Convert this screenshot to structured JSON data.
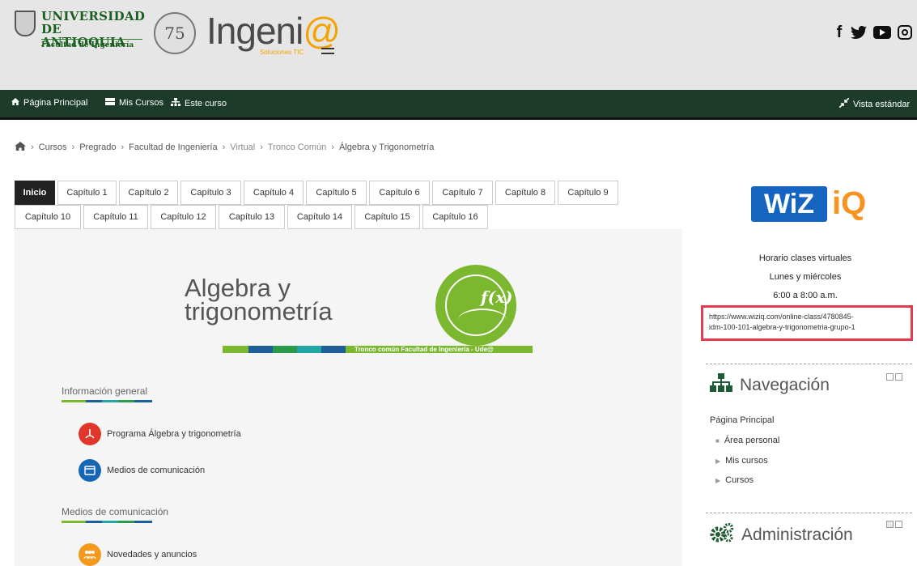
{
  "header": {
    "university_line1": "UNIVERSIDAD",
    "university_line2": "DE ANTIOQUIA",
    "faculty": "Facultad de Ingeniería",
    "anniversary": "75",
    "brand": "Ingeni",
    "brand_at": "@",
    "brand_sub": "Soluciones TIC",
    "social": {
      "facebook": "f",
      "twitter": "y"
    }
  },
  "navbar": {
    "home": "Página Principal",
    "my_courses": "Mis Cursos",
    "this_course": "Este curso",
    "view": "Vista estándar"
  },
  "breadcrumb": {
    "home_icon": "home-icon",
    "items": [
      "Cursos",
      "Pregrado",
      "Facultad de Ingeniería",
      "Virtual",
      "Tronco Común",
      "Álgebra y Trigonometría"
    ],
    "sep": "›"
  },
  "tabs": [
    "Inicio",
    "Capítulo 1",
    "Capítulo 2",
    "Capítulo 3",
    "Capítulo 4",
    "Capítulo 5",
    "Capítulo 6",
    "Capítulo 7",
    "Capítulo 8",
    "Capítulo 9",
    "Capítulo 10",
    "Capítulo 11",
    "Capítulo 12",
    "Capítulo 13",
    "Capítulo 14",
    "Capítulo 15",
    "Capítulo 16"
  ],
  "banner": {
    "title_line1": "Algebra y",
    "title_line2": "trigonometría",
    "fx": "f(x)",
    "stripe_text": "Tronco común Facultad de Ingeniería - Ude@"
  },
  "sections": {
    "general": {
      "title": "Información general",
      "items": [
        "Programa Álgebra y trigonometría",
        "Medios de comunicación"
      ]
    },
    "communication": {
      "title": "Medios de comunicación",
      "items": [
        "Novedades y anuncios"
      ]
    }
  },
  "sidebar": {
    "wiziq_wiz": "WiZ",
    "wiziq_iq": "iQ",
    "schedule_title": "Horario clases virtuales",
    "schedule_days": "Lunes y miércoles",
    "schedule_time": "6:00 a 8:00 a.m.",
    "url_line1": "https://www.wiziq.com/online-class/4780845-",
    "url_line2": "idm-100-101-algebra-y-trigonometria-grupo-1",
    "navigation": {
      "title": "Navegación",
      "items": [
        "Página Principal",
        "Área personal",
        "Mis cursos",
        "Cursos"
      ]
    },
    "administration": {
      "title": "Administración"
    }
  },
  "colors": {
    "navbar": "#1d3b2a",
    "accent_green": "#7cb82f",
    "highlight_red": "#e53950",
    "wiziq_blue": "#1565c0",
    "wiziq_orange": "#f7931e"
  }
}
